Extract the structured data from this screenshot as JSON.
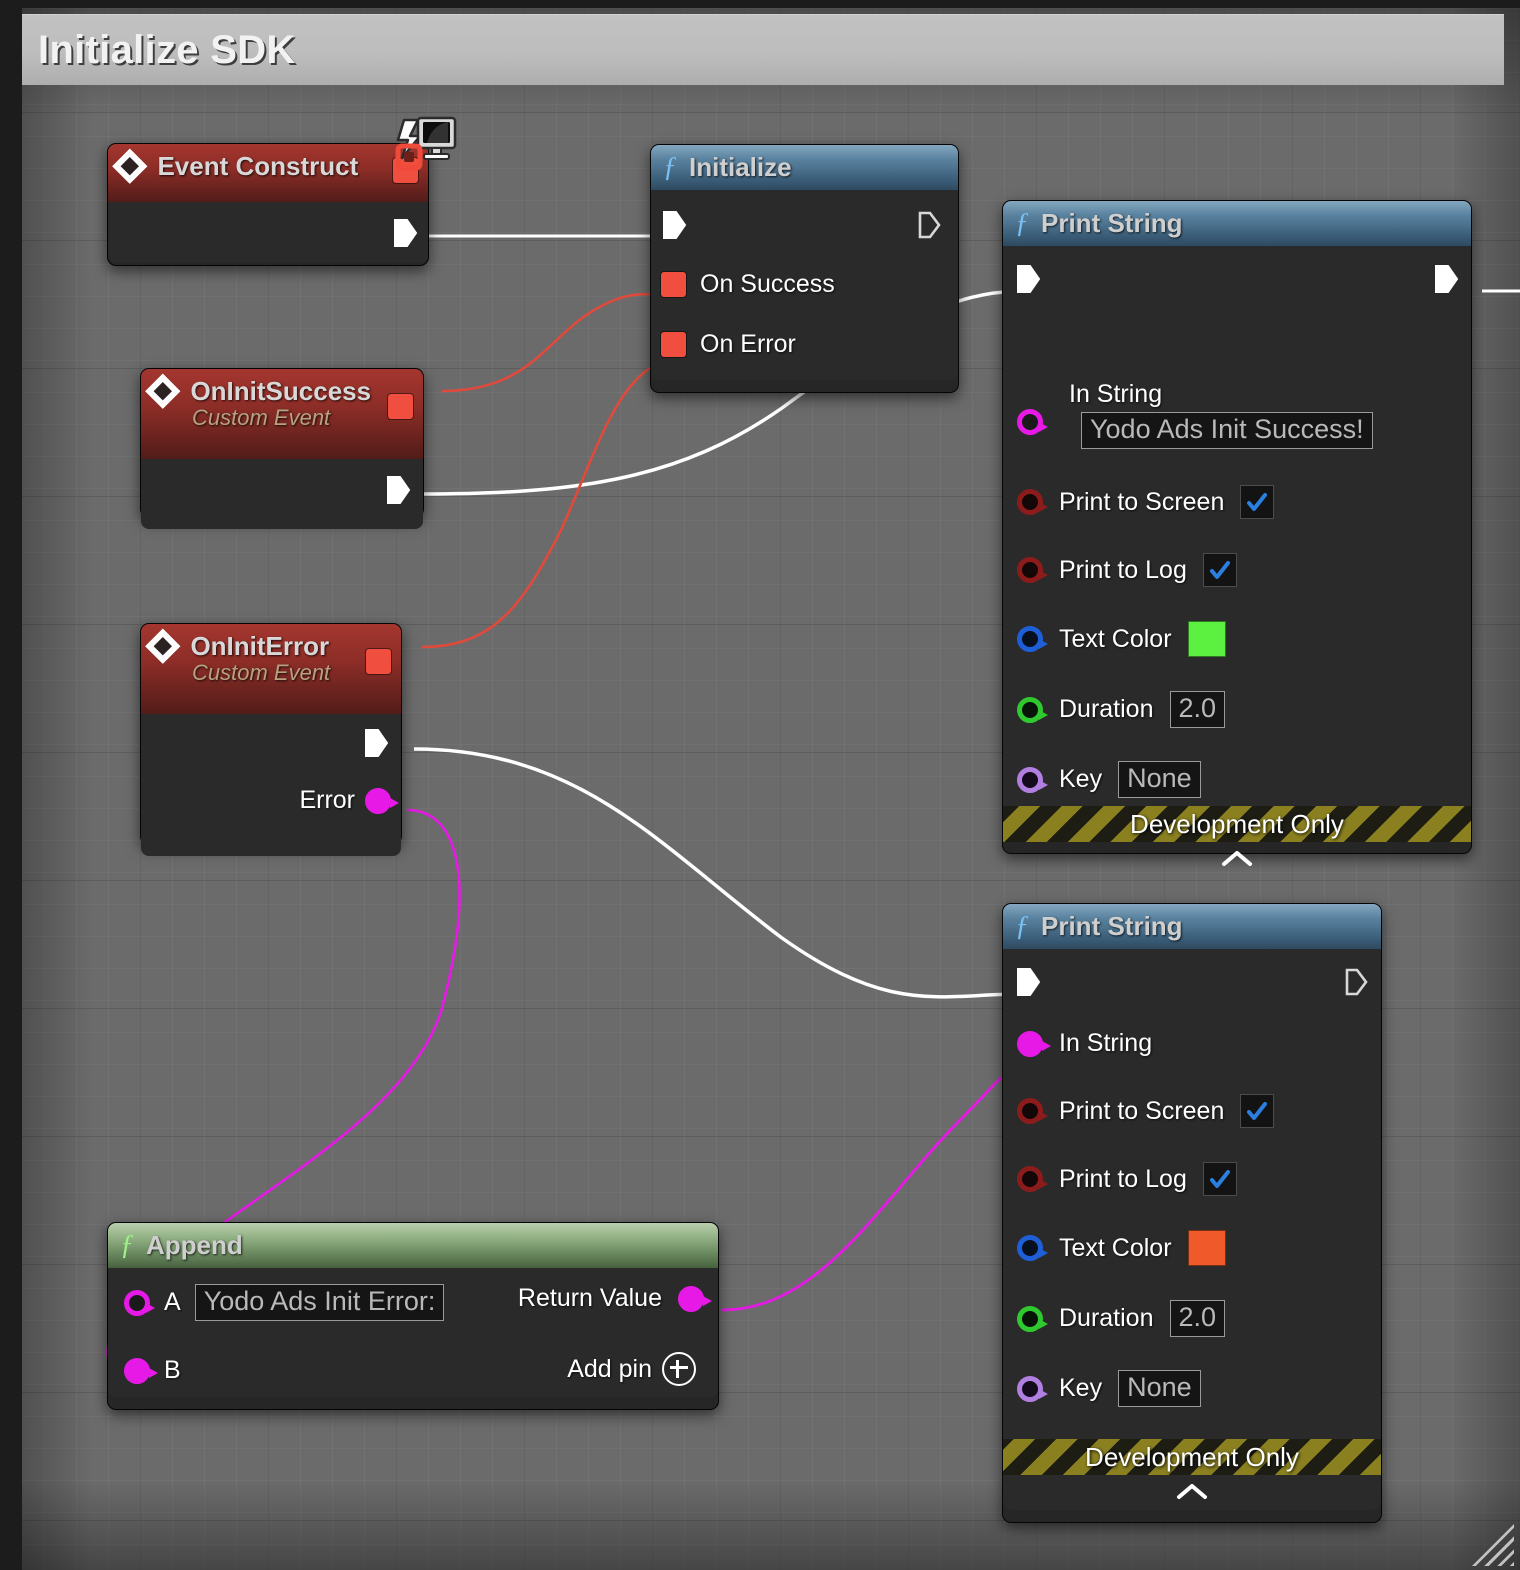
{
  "graph": {
    "title": "Initialize SDK",
    "background_color": "#6b6b6b"
  },
  "nodes": {
    "event_construct": {
      "title": "Event Construct",
      "icon": "event-diamond-icon",
      "delegate_pin": "delegate-pin",
      "exec_out": "exec-out-pin"
    },
    "on_init_success": {
      "title": "OnInitSuccess",
      "subtitle": "Custom Event",
      "icon": "event-diamond-icon"
    },
    "on_init_error": {
      "title": "OnInitError",
      "subtitle": "Custom Event",
      "icon": "event-diamond-icon",
      "error_pin_label": "Error"
    },
    "initialize": {
      "title": "Initialize",
      "icon": "function-f-icon",
      "pins": [
        "On Success",
        "On Error"
      ]
    },
    "print_string_success": {
      "title": "Print String",
      "icon": "function-f-icon",
      "in_string_label": "In String",
      "in_string_value": "Yodo Ads Init Success!",
      "print_to_screen_label": "Print to Screen",
      "print_to_screen_checked": true,
      "print_to_log_label": "Print to Log",
      "print_to_log_checked": true,
      "text_color_label": "Text Color",
      "text_color_value": "#5cf040",
      "duration_label": "Duration",
      "duration_value": "2.0",
      "key_label": "Key",
      "key_value": "None",
      "footer": "Development Only"
    },
    "print_string_error": {
      "title": "Print String",
      "icon": "function-f-icon",
      "in_string_label": "In String",
      "print_to_screen_label": "Print to Screen",
      "print_to_screen_checked": true,
      "print_to_log_label": "Print to Log",
      "print_to_log_checked": true,
      "text_color_label": "Text Color",
      "text_color_value": "#f05a2a",
      "duration_label": "Duration",
      "duration_value": "2.0",
      "key_label": "Key",
      "key_value": "None",
      "footer": "Development Only"
    },
    "append": {
      "title": "Append",
      "icon": "function-f-icon",
      "a_label": "A",
      "a_value": "Yodo Ads Init Error:",
      "b_label": "B",
      "return_label": "Return Value",
      "add_pin_label": "Add pin"
    }
  },
  "wire_colors": {
    "exec": "#ffffff",
    "delegate": "#e04a3c",
    "string": "#e619e6"
  }
}
